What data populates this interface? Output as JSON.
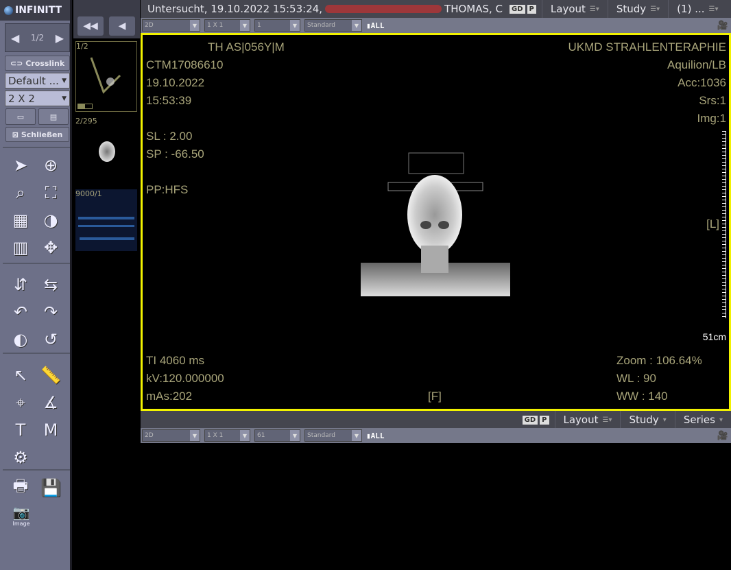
{
  "app": {
    "logo": "INFINITT"
  },
  "left": {
    "pager": "1/2",
    "crosslink": "Crosslink",
    "preset": "Default ...",
    "layout": "2 X 2",
    "close": "Schließen",
    "image_label": "Image",
    "tools": [
      "pointer-icon",
      "zoom-in-icon",
      "magnifier-icon",
      "fit-icon",
      "grid-icon",
      "window-level-icon",
      "xray-icon",
      "pan-icon",
      "flip-vertical-icon",
      "flip-horizontal-icon",
      "rotate-left-icon",
      "rotate-right-icon",
      "invert-icon",
      "undo-icon",
      "arrow-icon",
      "ruler-2d-icon",
      "crosshair-icon",
      "angle-icon",
      "text-icon",
      "m-icon",
      "sl-icon"
    ]
  },
  "thumbs": [
    {
      "label": "1/2"
    },
    {
      "label": "2/295"
    },
    {
      "label": "9000/1"
    }
  ],
  "top": {
    "title_prefix": "Untersucht, 19.10.2022 15:53:24,",
    "title_suffix": "THOMAS, C",
    "link": "GD",
    "p": "P",
    "layout": "Layout",
    "study": "Study",
    "series": "(1) ..."
  },
  "toolbar1": {
    "mode": "2D",
    "grid": "1 X 1",
    "index": "1",
    "preset": "Standard",
    "all": "ALL"
  },
  "overlay": {
    "tl": [
      "TH   AS|056Y|M",
      "CTM17086610",
      "19.10.2022",
      "15:53:39"
    ],
    "sl": "SL : 2.00",
    "sp": "SP : -66.50",
    "pp": "PP:HFS",
    "tr": [
      "UKMD STRAHLENTERAPHIE",
      "Aquilion/LB",
      "Acc:1036",
      "Srs:1",
      "Img:1"
    ],
    "l": "[L]",
    "f": "[F]",
    "scale": "51cm",
    "bl": [
      "TI 4060 ms",
      "kV:120.000000",
      "mAs:202"
    ],
    "br": [
      "Zoom : 106.64%",
      "WL : 90",
      "WW : 140"
    ]
  },
  "bottom": {
    "link": "GD",
    "p": "P",
    "layout": "Layout",
    "study": "Study",
    "series": "Series"
  },
  "toolbar2": {
    "mode": "2D",
    "grid": "1 X 1",
    "index": "61",
    "preset": "Standard",
    "all": "ALL"
  },
  "colors": {
    "active_border": "#f2f200",
    "overlay": "#a9a57a"
  }
}
